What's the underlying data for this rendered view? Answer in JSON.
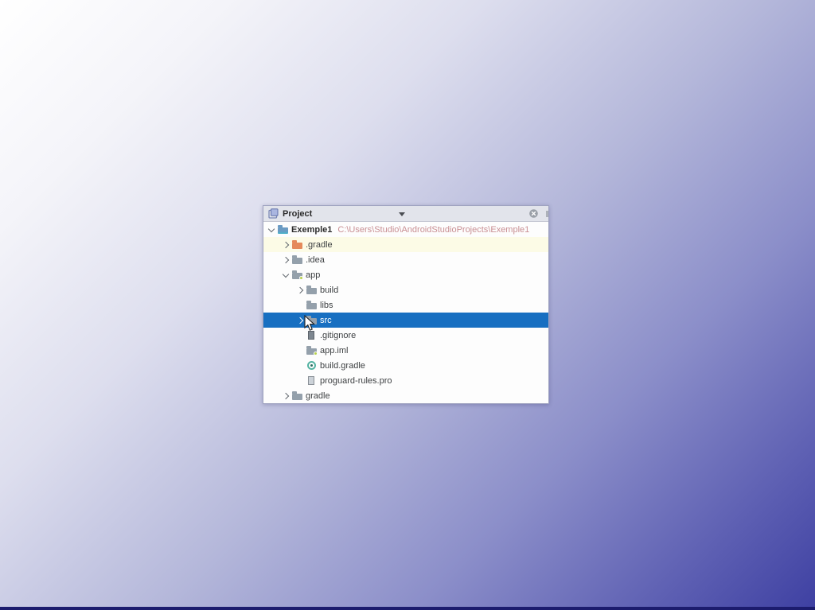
{
  "window": {
    "header": {
      "title": "Project",
      "tool_icon": "project-tool-window-icon",
      "dropdown_icon": "chevron-down-icon",
      "hide_icon": "hide-circle-x-icon"
    }
  },
  "tree": {
    "rows": [
      {
        "label": "Exemple1",
        "path": "C:\\Users\\Studio\\AndroidStudioProjects\\Exemple1",
        "level": 0,
        "chevron": "expanded",
        "icon": "project-folder-icon",
        "bold": true
      },
      {
        "label": ".gradle",
        "level": 1,
        "chevron": "collapsed",
        "icon": "folder-icon",
        "icon_color": "#e58a5b",
        "highlighted": true
      },
      {
        "label": ".idea",
        "level": 1,
        "chevron": "collapsed",
        "icon": "folder-icon"
      },
      {
        "label": "app",
        "level": 1,
        "chevron": "expanded",
        "icon": "module-folder-icon"
      },
      {
        "label": "build",
        "level": 2,
        "chevron": "collapsed",
        "icon": "folder-icon"
      },
      {
        "label": "libs",
        "level": 2,
        "chevron": "none",
        "icon": "folder-icon"
      },
      {
        "label": "src",
        "level": 2,
        "chevron": "collapsed",
        "icon": "folder-icon",
        "selected": true
      },
      {
        "label": ".gitignore",
        "level": 2,
        "chevron": "none",
        "icon": "gitignore-file-icon"
      },
      {
        "label": "app.iml",
        "level": 2,
        "chevron": "none",
        "icon": "module-file-icon"
      },
      {
        "label": "build.gradle",
        "level": 2,
        "chevron": "none",
        "icon": "gradle-file-icon"
      },
      {
        "label": "proguard-rules.pro",
        "level": 2,
        "chevron": "none",
        "icon": "file-icon"
      },
      {
        "label": "gradle",
        "level": 1,
        "chevron": "collapsed",
        "icon": "folder-icon"
      }
    ]
  },
  "colors": {
    "selection_blue": "#176fc1",
    "row_highlight": "#fcfbe6",
    "path_text": "#c98f93",
    "folder_gray": "#94a0ab",
    "folder_orange": "#e58a5b",
    "header_bg": "#e2e4eb",
    "background_gradient_end": "#3e40a2",
    "bottom_strip": "#1c1c6e"
  }
}
